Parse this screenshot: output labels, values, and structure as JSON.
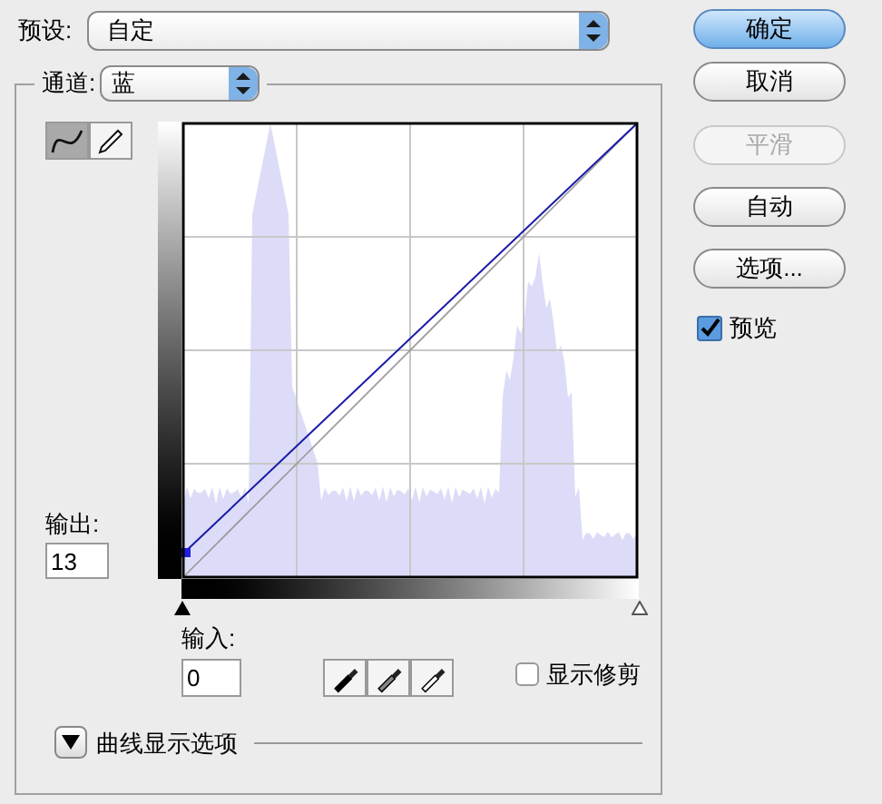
{
  "preset": {
    "label": "预设:",
    "value": "自定"
  },
  "channel": {
    "label": "通道:",
    "value": "蓝"
  },
  "tools": [
    {
      "kind": "curve",
      "selected": true
    },
    {
      "kind": "pencil",
      "selected": false
    }
  ],
  "output": {
    "label": "输出:",
    "value": "13"
  },
  "input": {
    "label": "输入:",
    "value": "0"
  },
  "input_sliders": [
    {
      "kind": "shadow",
      "level": 0
    },
    {
      "kind": "highlight",
      "level": 1
    }
  ],
  "eyedroppers": [
    {
      "kind": "black"
    },
    {
      "kind": "gray"
    },
    {
      "kind": "white"
    }
  ],
  "show_clipping": {
    "label": "显示修剪",
    "checked": false
  },
  "display_options": {
    "label": "曲线显示选项",
    "expanded": false
  },
  "buttons": [
    {
      "label": "确定",
      "default": true,
      "disabled": false
    },
    {
      "label": "取消",
      "default": false,
      "disabled": false
    },
    {
      "label": "平滑",
      "default": false,
      "disabled": true
    },
    {
      "label": "自动",
      "default": false,
      "disabled": false
    },
    {
      "label": "选项...",
      "default": false,
      "disabled": false
    }
  ],
  "preview": {
    "label": "预览",
    "checked": true
  }
}
